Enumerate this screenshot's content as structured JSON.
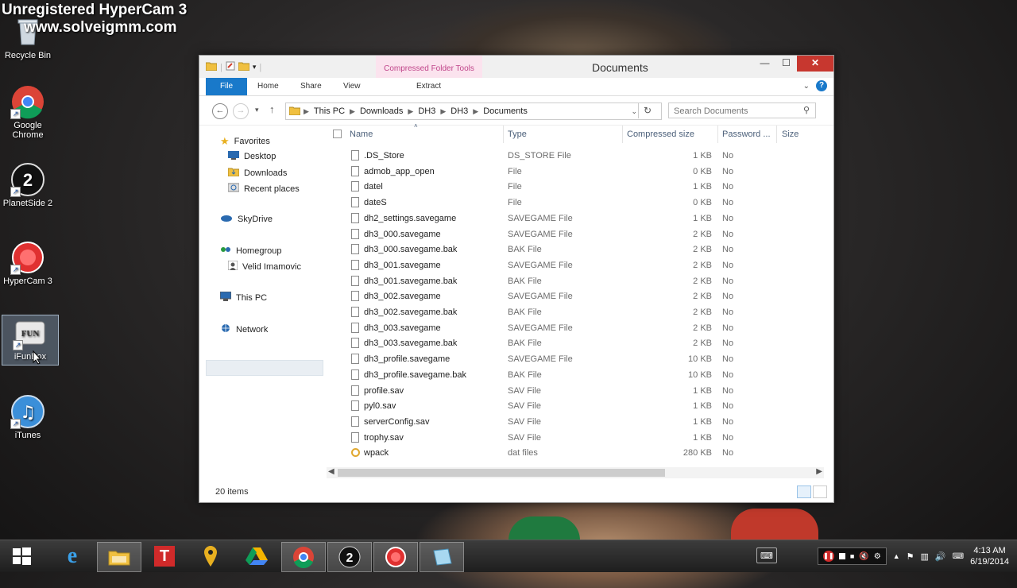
{
  "watermark": {
    "line1": "Unregistered HyperCam 3",
    "line2": "www.solveigmm.com"
  },
  "desktop_icons": [
    {
      "label": "Recycle Bin",
      "icon": "recycle-bin-icon"
    },
    {
      "label": "Google Chrome",
      "icon": "chrome-icon"
    },
    {
      "label": "PlanetSide 2",
      "icon": "planetside-icon"
    },
    {
      "label": "HyperCam 3",
      "icon": "hypercam-icon"
    },
    {
      "label": "iFunBox",
      "icon": "ifunbox-icon"
    },
    {
      "label": "iTunes",
      "icon": "itunes-icon"
    }
  ],
  "window": {
    "title": "Documents",
    "context_tab": "Compressed Folder Tools",
    "tabs": {
      "file": "File",
      "home": "Home",
      "share": "Share",
      "view": "View",
      "extract": "Extract"
    },
    "address": [
      "This PC",
      "Downloads",
      "DH3",
      "DH3",
      "Documents"
    ],
    "search_placeholder": "Search Documents",
    "nav": {
      "favorites": "Favorites",
      "desktop": "Desktop",
      "downloads": "Downloads",
      "recent": "Recent places",
      "skydrive": "SkyDrive",
      "homegroup": "Homegroup",
      "user": "Velid Imamovic",
      "thispc": "This PC",
      "network": "Network"
    },
    "columns": {
      "name": "Name",
      "type": "Type",
      "compressed": "Compressed size",
      "password": "Password ...",
      "size": "Size"
    },
    "files": [
      {
        "name": ".DS_Store",
        "type": "DS_STORE File",
        "size": "1 KB",
        "password": "No"
      },
      {
        "name": "admob_app_open",
        "type": "File",
        "size": "0 KB",
        "password": "No"
      },
      {
        "name": "datel",
        "type": "File",
        "size": "1 KB",
        "password": "No"
      },
      {
        "name": "dateS",
        "type": "File",
        "size": "0 KB",
        "password": "No"
      },
      {
        "name": "dh2_settings.savegame",
        "type": "SAVEGAME File",
        "size": "1 KB",
        "password": "No"
      },
      {
        "name": "dh3_000.savegame",
        "type": "SAVEGAME File",
        "size": "2 KB",
        "password": "No"
      },
      {
        "name": "dh3_000.savegame.bak",
        "type": "BAK File",
        "size": "2 KB",
        "password": "No"
      },
      {
        "name": "dh3_001.savegame",
        "type": "SAVEGAME File",
        "size": "2 KB",
        "password": "No"
      },
      {
        "name": "dh3_001.savegame.bak",
        "type": "BAK File",
        "size": "2 KB",
        "password": "No"
      },
      {
        "name": "dh3_002.savegame",
        "type": "SAVEGAME File",
        "size": "2 KB",
        "password": "No"
      },
      {
        "name": "dh3_002.savegame.bak",
        "type": "BAK File",
        "size": "2 KB",
        "password": "No"
      },
      {
        "name": "dh3_003.savegame",
        "type": "SAVEGAME File",
        "size": "2 KB",
        "password": "No"
      },
      {
        "name": "dh3_003.savegame.bak",
        "type": "BAK File",
        "size": "2 KB",
        "password": "No"
      },
      {
        "name": "dh3_profile.savegame",
        "type": "SAVEGAME File",
        "size": "10 KB",
        "password": "No"
      },
      {
        "name": "dh3_profile.savegame.bak",
        "type": "BAK File",
        "size": "10 KB",
        "password": "No"
      },
      {
        "name": "profile.sav",
        "type": "SAV File",
        "size": "1 KB",
        "password": "No"
      },
      {
        "name": "pyl0.sav",
        "type": "SAV File",
        "size": "1 KB",
        "password": "No"
      },
      {
        "name": "serverConfig.sav",
        "type": "SAV File",
        "size": "1 KB",
        "password": "No"
      },
      {
        "name": "trophy.sav",
        "type": "SAV File",
        "size": "1 KB",
        "password": "No"
      },
      {
        "name": "wpack",
        "type": "dat files",
        "size": "280 KB",
        "password": "No"
      }
    ],
    "status": "20 items"
  },
  "taskbar": {
    "clock_time": "4:13 AM",
    "clock_date": "6/19/2014",
    "apps": [
      "start-icon",
      "ie-icon",
      "explorer-icon",
      "t-app-icon",
      "maps-icon",
      "drive-icon",
      "chrome-icon",
      "planetside-icon",
      "hypercam-icon",
      "ifunbox-icon"
    ]
  }
}
